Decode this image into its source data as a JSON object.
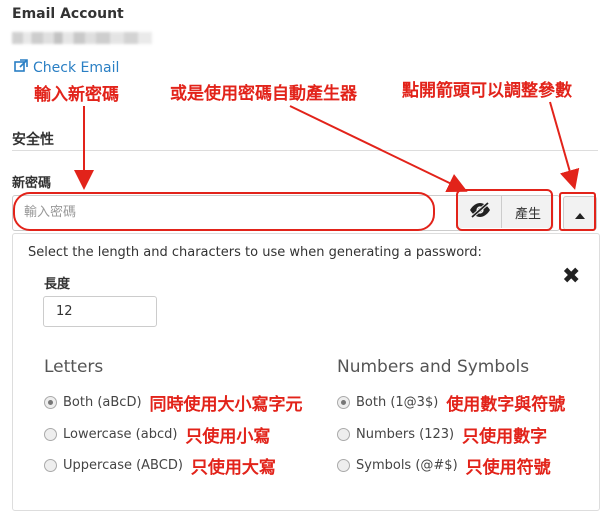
{
  "account": {
    "label": "Email Account",
    "check_email": "Check Email"
  },
  "annotations": {
    "new_password": "輸入新密碼",
    "generator": "或是使用密碼自動產生器",
    "arrow": "點開箭頭可以調整參數"
  },
  "section": {
    "title": "安全性"
  },
  "password": {
    "label": "新密碼",
    "placeholder": "輸入密碼",
    "generate_label": "產生"
  },
  "generator": {
    "description": "Select the length and characters to use when generating a password:",
    "length_label": "長度",
    "length_value": "12",
    "letters": {
      "title": "Letters",
      "options": [
        {
          "label": "Both (aBcD)",
          "note": "同時使用大小寫字元",
          "selected": true
        },
        {
          "label": "Lowercase (abcd)",
          "note": "只使用小寫",
          "selected": false
        },
        {
          "label": "Uppercase (ABCD)",
          "note": "只使用大寫",
          "selected": false
        }
      ]
    },
    "numbers": {
      "title": "Numbers and Symbols",
      "options": [
        {
          "label": "Both (1@3$)",
          "note": "使用數字與符號",
          "selected": true
        },
        {
          "label": "Numbers (123)",
          "note": "只使用數字",
          "selected": false
        },
        {
          "label": "Symbols (@#$)",
          "note": "只使用符號",
          "selected": false
        }
      ]
    }
  },
  "colors": {
    "annotation": "#e2231a",
    "link": "#2a7fc4"
  }
}
